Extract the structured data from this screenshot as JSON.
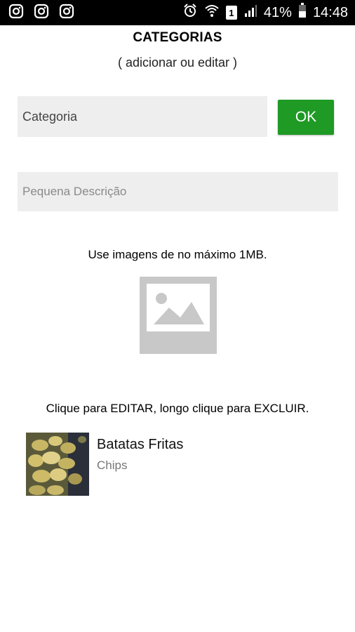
{
  "status_bar": {
    "left_icons": [
      "instagram-icon",
      "instagram-icon",
      "instagram-icon"
    ],
    "battery": "41%",
    "time": "14:48",
    "sim_label": "1"
  },
  "header": {
    "title": "CATEGORIAS",
    "subtitle": "( adicionar ou editar )"
  },
  "form": {
    "category_placeholder": "Categoria",
    "ok_label": "OK",
    "description_placeholder": "Pequena Descrição",
    "image_hint": "Use imagens de no máximo 1MB."
  },
  "list": {
    "hint": "Clique para EDITAR, longo clique para EXCLUIR.",
    "items": [
      {
        "title": "Batatas Fritas",
        "subtitle": "Chips"
      }
    ]
  },
  "colors": {
    "accent": "#1e9a25",
    "input_bg": "#eeeeee",
    "placeholder_icon": "#c8c8c8"
  }
}
